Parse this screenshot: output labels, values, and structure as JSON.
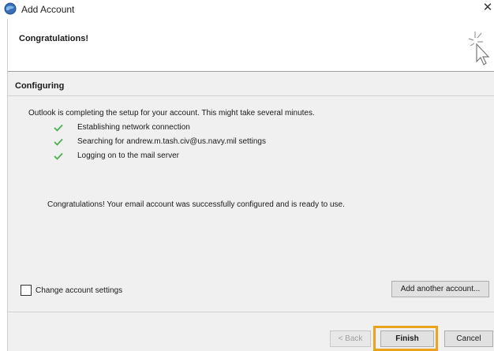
{
  "window": {
    "title": "Add Account",
    "close_glyph": "✕",
    "app_icon": "outlook-globe-icon"
  },
  "header": {
    "title": "Congratulations!",
    "icon": "wizard-sparkle-cursor-icon"
  },
  "section": {
    "title": "Configuring",
    "intro": "Outlook is completing the setup for your account. This might take several minutes."
  },
  "steps": [
    {
      "label": "Establishing network connection",
      "status": "done"
    },
    {
      "label": "Searching for andrew.m.tash.civ@us.navy.mil settings",
      "status": "done"
    },
    {
      "label": "Logging on to the mail server",
      "status": "done"
    }
  ],
  "success_message": "Congratulations! Your email account was successfully configured and is ready to use.",
  "options": {
    "change_settings_label": "Change account settings",
    "change_settings_checked": false
  },
  "buttons": {
    "add_another": "Add another account...",
    "back": "< Back",
    "finish": "Finish",
    "cancel": "Cancel"
  },
  "colors": {
    "check": "#4caf50",
    "highlight": "#e9a41b",
    "panel": "#f0f0f0"
  }
}
